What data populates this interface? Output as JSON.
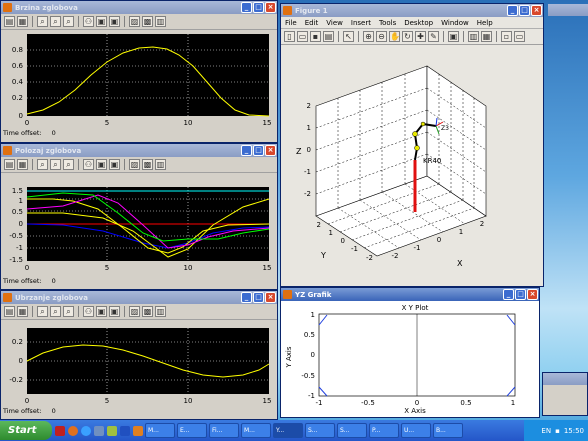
{
  "scope1": {
    "title": "Brzina zglobova",
    "offset_label": "Time offset:",
    "offset_value": "0",
    "yticks": [
      "0.8",
      "0.6",
      "0.4",
      "0.2",
      "0"
    ],
    "xticks": [
      "0",
      "5",
      "10",
      "15"
    ]
  },
  "scope2": {
    "title": "Polozaj zglobova",
    "offset_label": "Time offset:",
    "offset_value": "0",
    "yticks": [
      "1.5",
      "1",
      "0.5",
      "0",
      "-0.5",
      "-1",
      "-1.5"
    ],
    "xticks": [
      "0",
      "5",
      "10",
      "15"
    ]
  },
  "scope3": {
    "title": "Ubrzanje zglobova",
    "offset_label": "Time offset:",
    "offset_value": "0",
    "yticks": [
      "0.2",
      "0",
      "-0.2"
    ],
    "xticks": [
      "0",
      "5",
      "10",
      "15"
    ]
  },
  "figure": {
    "title": "Figure 1",
    "menu": [
      "File",
      "Edit",
      "View",
      "Insert",
      "Tools",
      "Desktop",
      "Window",
      "Help"
    ],
    "zticks": [
      "2",
      "1",
      "0",
      "-1",
      "-2"
    ],
    "yticks": [
      "2",
      "1",
      "0",
      "-1",
      "-2"
    ],
    "xticks": [
      "-2",
      "-1",
      "0",
      "1",
      "2"
    ],
    "zlabel": "Z",
    "ylabel": "Y",
    "xlabel": "X",
    "robot_label": "KR40",
    "end_label": "Z3"
  },
  "yz": {
    "title": "YZ Grafik",
    "plot_title": "X Y Plot",
    "xlabel": "X Axis",
    "ylabel": "Y Axis",
    "xticks": [
      "-1",
      "-0.5",
      "0",
      "0.5",
      "1"
    ],
    "yticks": [
      "1",
      "0.5",
      "0",
      "-0.5",
      "-1"
    ]
  },
  "taskbar": {
    "start": "Start",
    "tasks": [
      "M...",
      "E...",
      "Fi...",
      "M...",
      "Y...",
      "S...",
      "S...",
      "P...",
      "U...",
      "B..."
    ],
    "lang": "EN",
    "clock": "15:50"
  },
  "colors": {
    "scope_bg": "#000000",
    "yellow": "#ffff00",
    "magenta": "#ff00ff",
    "cyan": "#00ffff",
    "red": "#ff0000",
    "green": "#00ff00",
    "blue": "#0000ff",
    "link": "#ff0000"
  }
}
